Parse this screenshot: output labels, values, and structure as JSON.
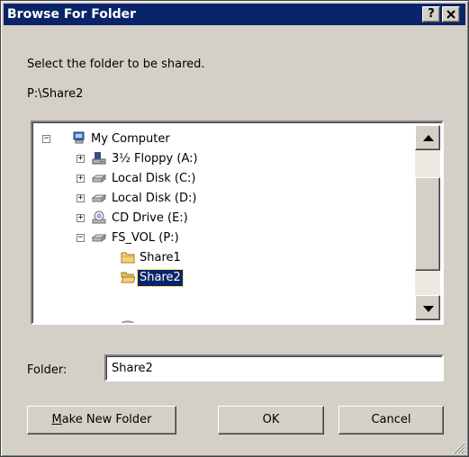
{
  "window": {
    "title": "Browse For Folder",
    "help_label": "?",
    "close_label": "✕"
  },
  "prompt": "Select the folder to be shared.",
  "current_path": "P:\\Share2",
  "tree": {
    "items": [
      {
        "label": "My Computer",
        "expander": "−",
        "icon": "my-computer-icon"
      },
      {
        "label": "3½ Floppy (A:)",
        "expander": "+",
        "icon": "floppy-drive-icon"
      },
      {
        "label": "Local Disk (C:)",
        "expander": "+",
        "icon": "hard-disk-icon"
      },
      {
        "label": "Local Disk (D:)",
        "expander": "+",
        "icon": "hard-disk-icon"
      },
      {
        "label": "CD Drive (E:)",
        "expander": "+",
        "icon": "cd-drive-icon"
      },
      {
        "label": "FS_VOL (P:)",
        "expander": "−",
        "icon": "network-disk-icon"
      },
      {
        "label": "Share1",
        "icon": "folder-icon"
      },
      {
        "label": "Share2",
        "icon": "open-folder-icon",
        "selected": true
      }
    ]
  },
  "folder": {
    "label": "Folder:",
    "value": "Share2"
  },
  "buttons": {
    "make_new_folder": "Make New Folder",
    "make_new_folder_accel": "M",
    "make_new_folder_rest": "ake New Folder",
    "ok": "OK",
    "cancel": "Cancel"
  },
  "colors": {
    "title_bar": "#0a246a",
    "face": "#d4d0c8",
    "selection": "#0a246a"
  }
}
